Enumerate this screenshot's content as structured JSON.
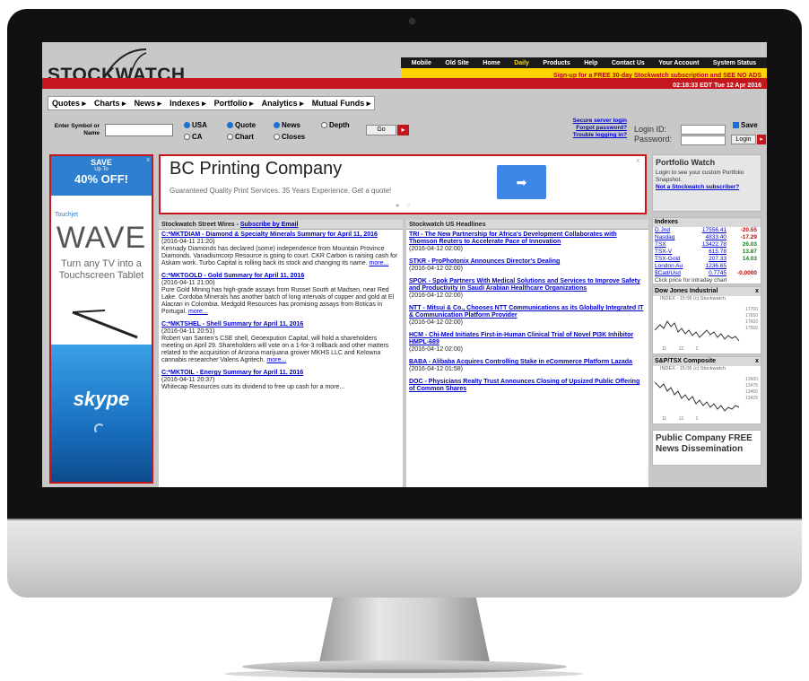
{
  "site": {
    "logo_text": "STOCKWATCH"
  },
  "top_nav": [
    "Mobile",
    "Old Site",
    "Home",
    "Daily",
    "Products",
    "Help",
    "Contact Us",
    "Your Account",
    "System Status"
  ],
  "promo": "Sign-up for a FREE 30-day Stockwatch subscription and SEE NO ADS",
  "timestamp": "02:18:33 EDT Tue 12 Apr 2016",
  "main_menu": [
    "Quotes ▸",
    "Charts ▸",
    "News ▸",
    "Indexes ▸",
    "Portfolio ▸",
    "Analytics ▸",
    "Mutual Funds ▸"
  ],
  "search": {
    "label": "Enter Symbol or Name",
    "markets": [
      "USA",
      "CA"
    ],
    "modes": [
      "Quote",
      "Chart",
      "News",
      "Closes",
      "Depth"
    ],
    "go": "Go"
  },
  "login": {
    "links": [
      "Secure server login",
      "Forgot password?",
      "Trouble logging in?"
    ],
    "id_label": "Login ID:",
    "pw_label": "Password:",
    "save_label": "Save",
    "button": "Login"
  },
  "left_ad": {
    "save": "SAVE",
    "upto": "Up To",
    "off": "40% OFF!",
    "brand": "Touchjet",
    "headline": "WAVE",
    "sub": "Turn any TV into a Touchscreen Tablet",
    "skype": "skype",
    "close": "x"
  },
  "top_ad": {
    "title": "BC Printing Company",
    "desc": "Guaranteed Quality Print Services. 35 Years Experience. Get a quote!",
    "arrow": "➡",
    "close": "x",
    "dots": "● ○"
  },
  "street_wires": {
    "header": "Stockwatch Street Wires - ",
    "subscribe": "Subscribe by Email",
    "items": [
      {
        "title": "C:*MKTDIAM - Diamond & Specialty Minerals Summary for April 11, 2016",
        "date": "(2016-04-11 21:20)",
        "body": "Kennady Diamonds has declared (some) independence from Mountain Province Diamonds. Vanadiumcorp Resource is going to court. CKR Carbon is raising cash for Askam work. Turbo Capital is rolling back its stock and changing its name.",
        "more": "more..."
      },
      {
        "title": "C:*MKTGOLD - Gold Summary for April 11, 2016",
        "date": "(2016-04-11 21:00)",
        "body": "Pure Gold Mining has high-grade assays from Russet South at Madsen, near Red Lake. Cordoba Minerals has another batch of long intervals of copper and gold at El Alacran in Colombia. Medgold Resources has promising assays from Boticas in Portugal.",
        "more": "more..."
      },
      {
        "title": "C:*MKTSHEL - Shell Summary for April 11, 2016",
        "date": "(2016-04-11 20:51)",
        "body": "Robert van Santen's CSE shell, Geoexpution Capital, will hold a shareholders meeting on April 29. Shareholders will vote on a 1-for-3 rollback and other matters related to the acquisition of Arizona marijuana grower MKHS LLC and Kelowna cannabis researcher Valens Agritech.",
        "more": "more..."
      },
      {
        "title": "C:*MKTOIL - Energy Summary for April 11, 2016",
        "date": "(2016-04-11 20:37)",
        "body": "Whitecap Resources cuts its dividend to free up cash for a more...",
        "more": ""
      }
    ]
  },
  "us_headlines": {
    "header": "Stockwatch US Headlines",
    "items": [
      {
        "title": "TRI - The New Partnership for Africa's Development Collaborates with Thomson Reuters to Accelerate Pace of Innovation",
        "date": "(2016-04-12 02:00)"
      },
      {
        "title": "STKR - ProPhotonix Announces Director's Dealing",
        "date": "(2016-04-12 02:00)"
      },
      {
        "title": "SPOK - Spok Partners With Medical Solutions and Services to Improve Safety and Productivity in Saudi Arabian Healthcare Organizations",
        "date": "(2016-04-12 02:00)"
      },
      {
        "title": "NTT - Mitsui & Co., Chooses NTT Communications as its Globally Integrated IT & Communication Platform Provider",
        "date": "(2016-04-12 02:00)"
      },
      {
        "title": "HCM - Chi-Med Initiates First-in-Human Clinical Trial of Novel PI3K Inhibitor HMPL-689",
        "date": "(2016-04-12 02:00)"
      },
      {
        "title": "BABA - Alibaba Acquires Controlling Stake in eCommerce Platform Lazada",
        "date": "(2016-04-12 01:58)"
      },
      {
        "title": "DOC - Physicians Realty Trust Announces Closing of Upsized Public Offering of Common Shares",
        "date": ""
      }
    ]
  },
  "portfolio_watch": {
    "title": "Portfolio Watch",
    "body": "Login to see your custom Portfolio Snapshot.",
    "link": "Not a Stockwatch subscriber?"
  },
  "indexes": {
    "header": "Indexes",
    "rows": [
      {
        "name": "D.Jnd",
        "value": "17556.41",
        "change": "-20.55",
        "dir": "down"
      },
      {
        "name": "Nasdaq",
        "value": "4833.40",
        "change": "-17.29",
        "dir": "down"
      },
      {
        "name": "TSX",
        "value": "13422.78",
        "change": "26.03",
        "dir": "up"
      },
      {
        "name": "TSX-V",
        "value": "615.78",
        "change": "13.87",
        "dir": "up"
      },
      {
        "name": "TSX-Gold",
        "value": "207.33",
        "change": "14.03",
        "dir": "up"
      },
      {
        "name": "London Au",
        "value": "1236.65",
        "change": "",
        "dir": ""
      },
      {
        "name": "$Cad/Usd",
        "value": "0.7745",
        "change": "-0.0000",
        "dir": "down"
      }
    ],
    "note": "Click price for intraday chart"
  },
  "mini_charts": [
    {
      "title": "Dow Jones Industrial",
      "sub": "INDEX - 15:06 (c) Stockwatch",
      "close": "x",
      "yticks": [
        "17700",
        "17650",
        "17600",
        "17550"
      ],
      "xticks": [
        "11",
        "12",
        "2"
      ]
    },
    {
      "title": "S&P/TSX Composite",
      "sub": "INDEX - 15:06 (c) Stockwatch",
      "close": "x",
      "yticks": [
        "13500",
        "13475",
        "13450",
        "13425"
      ],
      "xticks": [
        "11",
        "12",
        "2"
      ]
    }
  ],
  "public_company": {
    "title": "Public Company FREE News Dissemination"
  }
}
